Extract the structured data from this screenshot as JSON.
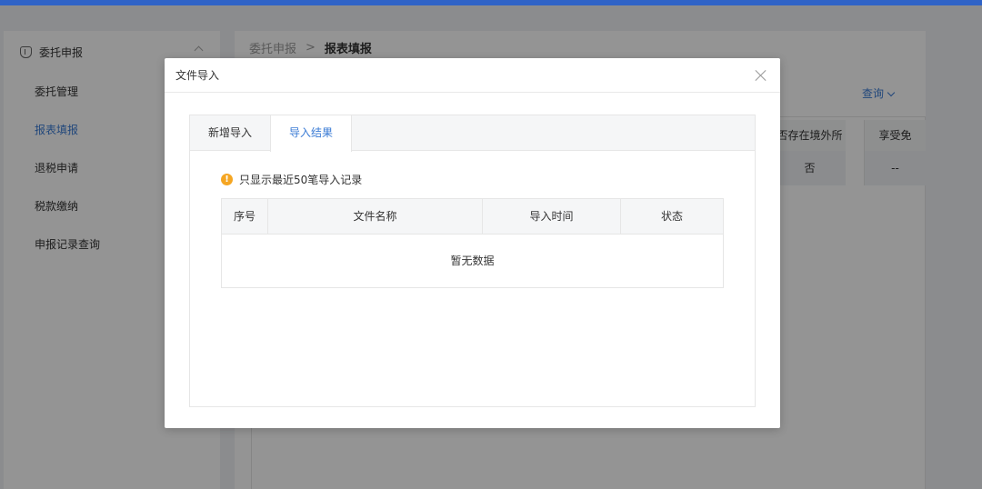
{
  "sidebar": {
    "group_label": "委托申报",
    "items": [
      {
        "label": "委托管理"
      },
      {
        "label": "报表填报"
      },
      {
        "label": "退税申请"
      },
      {
        "label": "税款缴纳"
      },
      {
        "label": "申报记录查询"
      }
    ],
    "active_index": 1
  },
  "breadcrumb": {
    "parent": "委托申报",
    "separator": ">",
    "current": "报表填报"
  },
  "main": {
    "query_label": "查询",
    "table_headers": [
      "否存在境外所得",
      "享受免"
    ],
    "table_row": [
      "否",
      "--"
    ]
  },
  "modal": {
    "title": "文件导入",
    "tabs": [
      {
        "label": "新增导入"
      },
      {
        "label": "导入结果"
      }
    ],
    "active_tab": 1,
    "notice": "只显示最近50笔导入记录",
    "columns": [
      "序号",
      "文件名称",
      "导入时间",
      "状态"
    ],
    "empty_text": "暂无数据"
  },
  "colors": {
    "accent": "#3a7bd5",
    "topbar": "#2f63c7",
    "warning": "#f5a623"
  }
}
